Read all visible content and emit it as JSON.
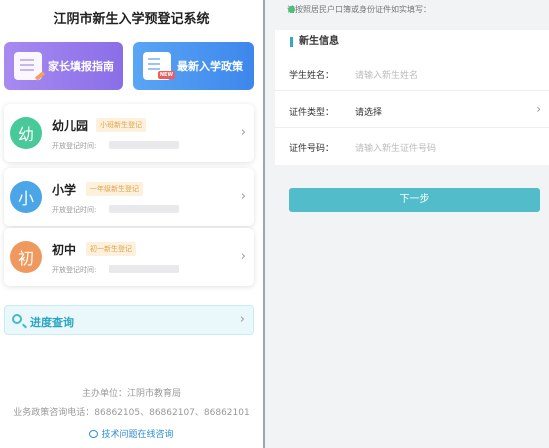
{
  "app": {
    "title": "江阴市新生入学预登记系统"
  },
  "shortcuts": {
    "guide_label": "家长填报指南",
    "policy_label": "最新入学政策"
  },
  "schools": [
    {
      "name": "幼儿园",
      "char": "幼",
      "tag": "小班新生登记",
      "time_label": "开放登记时间:",
      "color": "#48c99a"
    },
    {
      "name": "小学",
      "char": "小",
      "tag": "一年级新生登记",
      "time_label": "开放登记时间:",
      "color": "#4aa6e6"
    },
    {
      "name": "初中",
      "char": "初",
      "tag": "初一新生登记",
      "time_label": "开放登记时间:",
      "color": "#f0995e"
    }
  ],
  "progress": {
    "label": "进度查询"
  },
  "footer": {
    "organizer": "主办单位：江阴市教育局",
    "hotline": "业务政策咨询电话：86862105、86862107、86862101",
    "support": "技术问题在线咨询"
  },
  "form": {
    "notice": "请按照居民户口簿或身份证件如实填写：",
    "section_title": "新生信息",
    "fields": [
      {
        "label": "学生姓名：",
        "value": "请输入新生姓名"
      },
      {
        "label": "证件类型：",
        "value": "请选择"
      },
      {
        "label": "证件号码：",
        "value": "请输入新生证件号码"
      }
    ],
    "next_label": "下一步"
  },
  "icons": [
    "guide-icon",
    "policy-icon",
    "search-icon",
    "chevron-right-icon",
    "chat-icon"
  ]
}
